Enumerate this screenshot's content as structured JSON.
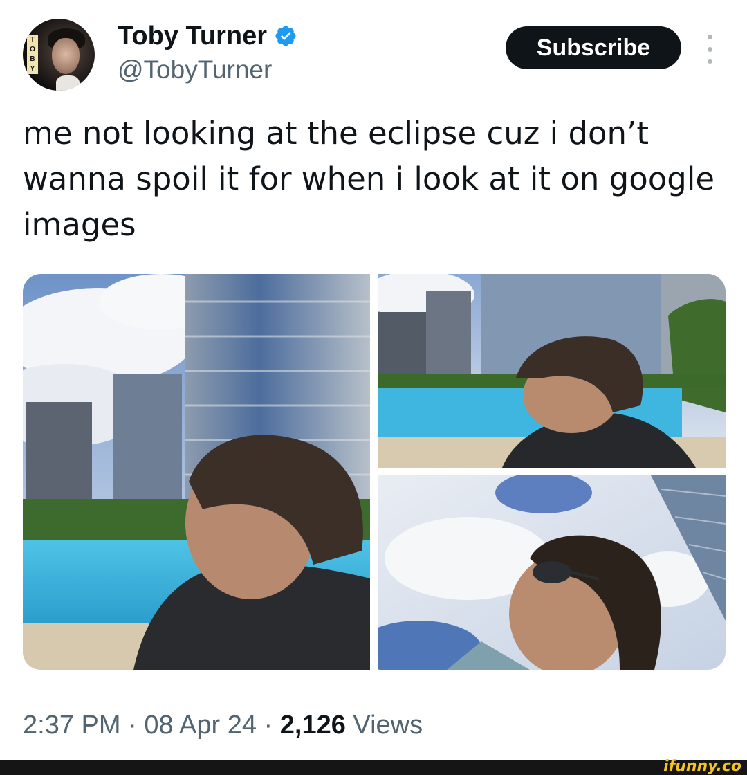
{
  "author": {
    "display_name": "Toby Turner",
    "handle": "@TobyTurner",
    "verified": true,
    "verified_color": "#1d9bf0",
    "avatar_logo_letters": [
      "T",
      "O",
      "B",
      "Y"
    ]
  },
  "actions": {
    "subscribe_label": "Subscribe",
    "more_icon": "more-vertical-icon"
  },
  "tweet": {
    "text": "me not looking at the eclipse cuz i don’t wanna spoil it for when i look at it on google images",
    "media_count": 3
  },
  "meta": {
    "time": "2:37 PM",
    "separator": " · ",
    "date": "08 Apr 24",
    "views_count": "2,126",
    "views_label": " Views"
  },
  "watermark": {
    "text": "ifunny.co"
  },
  "colors": {
    "text_primary": "#0f1419",
    "text_secondary": "#536471",
    "subscribe_bg": "#0f1419",
    "watermark": "#f6c51b"
  }
}
